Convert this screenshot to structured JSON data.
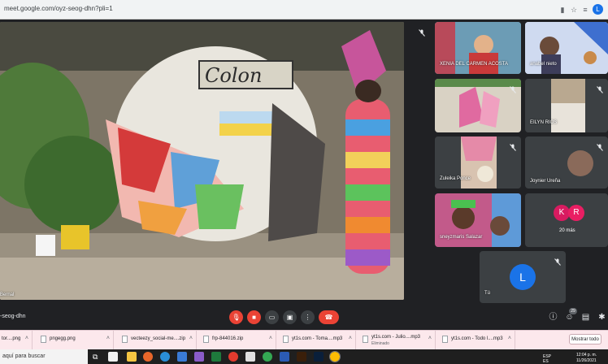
{
  "browser": {
    "url": "meet.google.com/oyz-seog-dhn?pli=1",
    "profile_initial": "L"
  },
  "meeting": {
    "code": "-seog-dhn",
    "main_speaker_name": "Bernal"
  },
  "tiles": [
    {
      "name": "XENIA DEL CARMEN ACOSTA"
    },
    {
      "name": "anabel nieto"
    },
    {
      "name": ""
    },
    {
      "name": "EILYN RIOS"
    },
    {
      "name": "Zuleika Ponce"
    },
    {
      "name": "Joynier Ureña",
      "avatar_initial": ""
    },
    {
      "name": "sneyzmaris Salazar"
    },
    {
      "name": "20 más",
      "avatar_initials": [
        "K",
        "R"
      ]
    },
    {
      "name": "Tú",
      "avatar_initial": "L"
    }
  ],
  "controls": {
    "participants_count": "29"
  },
  "downloads": [
    {
      "name": "tor....png"
    },
    {
      "name": "pngegg.png"
    },
    {
      "name": "vecteezy_social-me....zip"
    },
    {
      "name": "frp-844016.zip"
    },
    {
      "name": "yt1s.com - Toma....mp3"
    },
    {
      "name": "yt1s.com - Julio....mp3",
      "sub": "Eliminado"
    },
    {
      "name": "yt1s.com - Todo l....mp3"
    }
  ],
  "show_all_label": "Mostrar todo",
  "taskbar": {
    "search_placeholder": "aquí para buscar",
    "lang": "ESP",
    "lang_sub": "ES",
    "time": "12:04 p. m.",
    "date": "11/26/2021"
  },
  "colors": {
    "meet_bg": "#202124",
    "tile_bg": "#3c4043",
    "end_call": "#ea4335",
    "avatar_k": "#d81b60",
    "avatar_r": "#e91e63",
    "avatar_l": "#1a73e8"
  }
}
